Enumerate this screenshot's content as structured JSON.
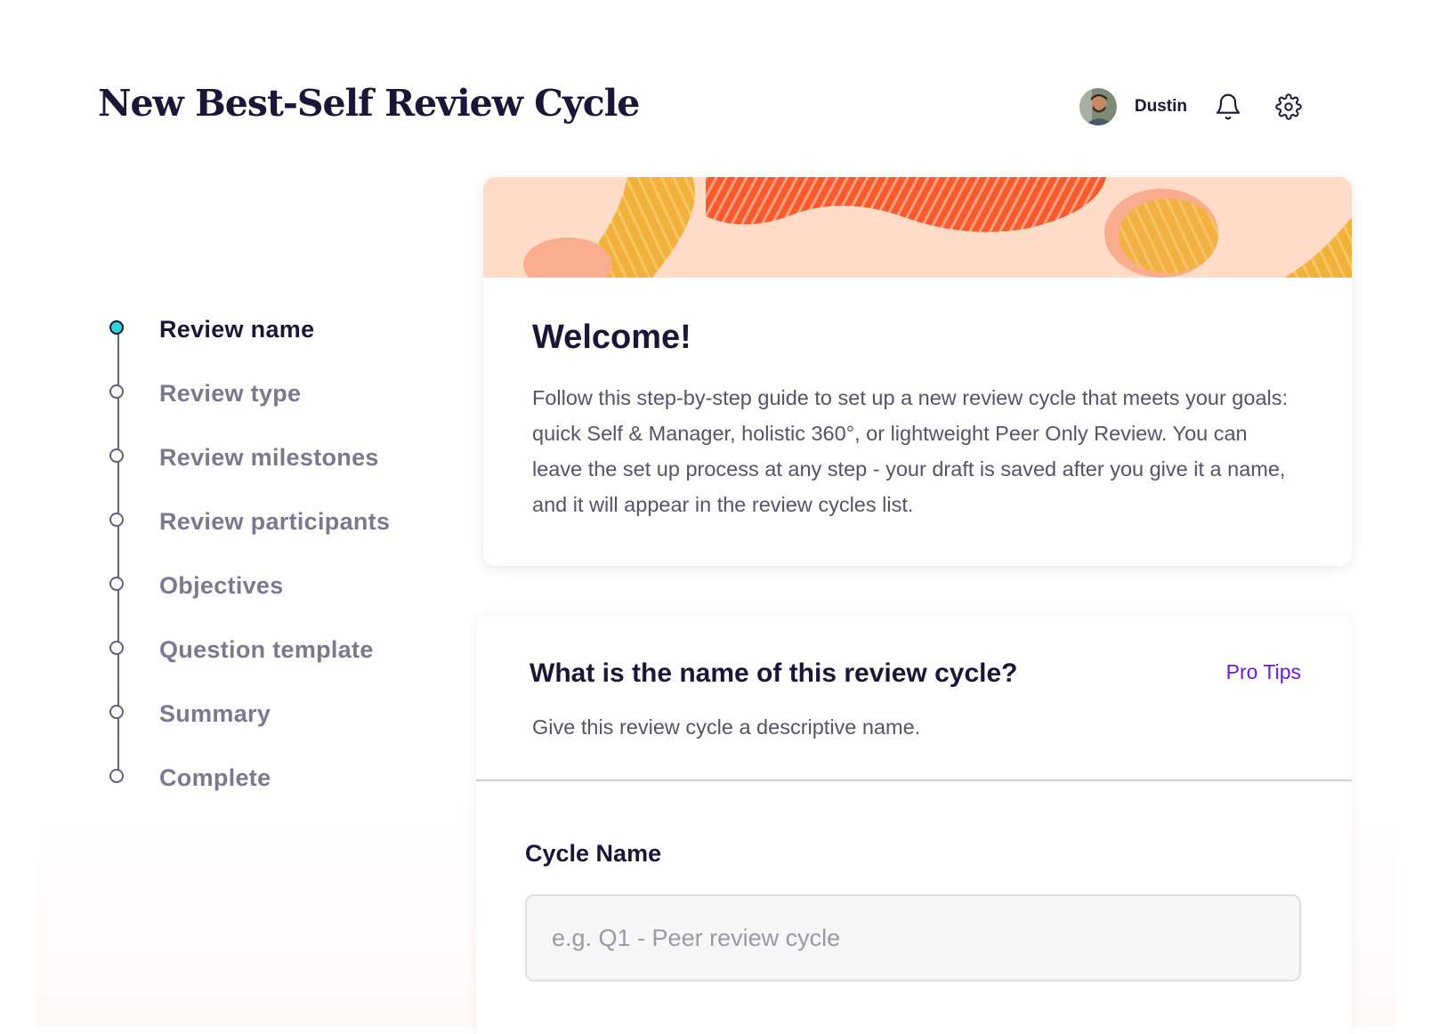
{
  "header": {
    "title": "New Best-Self Review Cycle",
    "user_name": "Dustin",
    "icons": [
      "avatar",
      "bell-icon",
      "gear-icon"
    ]
  },
  "stepper": {
    "steps": [
      {
        "label": "Review name",
        "active": true
      },
      {
        "label": "Review type",
        "active": false
      },
      {
        "label": "Review milestones",
        "active": false
      },
      {
        "label": "Review participants",
        "active": false
      },
      {
        "label": "Objectives",
        "active": false
      },
      {
        "label": "Question template",
        "active": false
      },
      {
        "label": "Summary",
        "active": false
      },
      {
        "label": "Complete",
        "active": false
      }
    ]
  },
  "welcome": {
    "title": "Welcome!",
    "body": "Follow this step-by-step guide to set up a new review cycle that meets your goals: quick Self & Manager, holistic 360°, or lightweight Peer Only Review. You can leave the set up process at any step - your draft is saved after you give it a name, and it will appear in the review cycles list."
  },
  "form": {
    "question": "What is the name of this review cycle?",
    "pro_tips": "Pro Tips",
    "hint": "Give this review cycle a descriptive name.",
    "field_label": "Cycle Name",
    "input_value": "",
    "input_placeholder": "e.g. Q1 - Peer review cycle"
  },
  "colors": {
    "primary_text": "#1a1638",
    "muted_text": "#7b7890",
    "active_step": "#2ed3d9",
    "link": "#6a1ad9",
    "banner_bg": "#fedcc7",
    "banner_orange": "#f85a2c",
    "banner_yellow": "#f2b13a"
  }
}
